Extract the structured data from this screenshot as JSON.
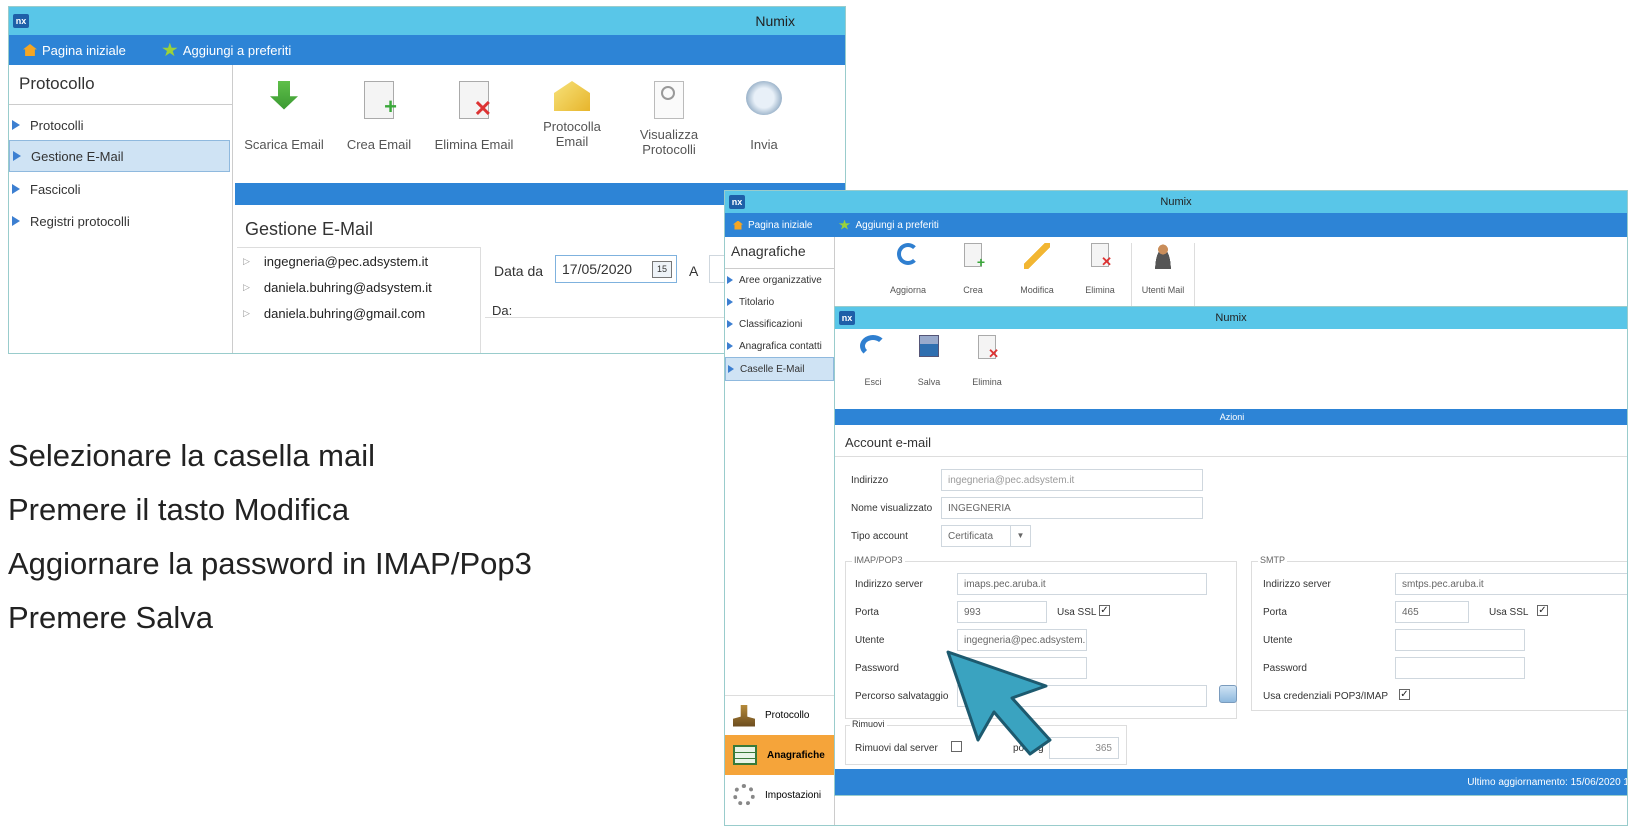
{
  "window1": {
    "title": "Numix",
    "logo": "nx",
    "nav": {
      "home": "Pagina iniziale",
      "favorites": "Aggiungi a preferiti"
    },
    "sidebar": {
      "header": "Protocollo",
      "items": [
        {
          "label": "Protocolli"
        },
        {
          "label": "Gestione E-Mail"
        },
        {
          "label": "Fascicoli"
        },
        {
          "label": "Registri protocolli"
        }
      ]
    },
    "toolbar": [
      {
        "label": "Scarica Email",
        "icon": "download-icon"
      },
      {
        "label": "Crea Email",
        "icon": "new-document-icon"
      },
      {
        "label": "Elimina Email",
        "icon": "delete-document-icon"
      },
      {
        "label": "Protocolla Email",
        "icon": "open-envelope-icon"
      },
      {
        "label": "Visualizza Protocolli",
        "icon": "magnifier-icon"
      },
      {
        "label": "Invia",
        "icon": "send-icon"
      }
    ],
    "section_title": "Gestione E-Mail",
    "mailboxes": [
      "ingegneria@pec.adsystem.it",
      "daniela.buhring@adsystem.it",
      "daniela.buhring@gmail.com"
    ],
    "date_from_label": "Data da",
    "date_from_value": "17/05/2020",
    "calendar_day": "15",
    "date_to_label": "A",
    "from_label": "Da:"
  },
  "instructions": [
    "Selezionare la  casella mail",
    "Premere il tasto Modifica",
    "Aggiornare la password in IMAP/Pop3",
    "Premere Salva"
  ],
  "window2": {
    "title": "Numix",
    "logo": "nx",
    "nav": {
      "home": "Pagina iniziale",
      "favorites": "Aggiungi a preferiti"
    },
    "sidebar": {
      "header": "Anagrafiche",
      "items": [
        {
          "label": "Aree organizzative"
        },
        {
          "label": "Titolario"
        },
        {
          "label": "Classificazioni"
        },
        {
          "label": "Anagrafica contatti"
        },
        {
          "label": "Caselle E-Mail"
        }
      ],
      "modules": [
        {
          "label": "Protocollo",
          "icon": "stamp-icon"
        },
        {
          "label": "Anagrafiche",
          "icon": "table-icon"
        },
        {
          "label": "Impostazioni",
          "icon": "gear-icon"
        }
      ]
    },
    "toolbar": [
      {
        "label": "Aggiorna",
        "icon": "refresh-icon"
      },
      {
        "label": "Crea",
        "icon": "new-document-icon"
      },
      {
        "label": "Modifica",
        "icon": "pencil-icon"
      },
      {
        "label": "Elimina",
        "icon": "delete-document-icon"
      },
      {
        "label": "Utenti Mail",
        "icon": "user-icon"
      }
    ]
  },
  "window3": {
    "title": "Numix",
    "logo": "nx",
    "toolbar": [
      {
        "label": "Esci",
        "icon": "back-arrow-icon"
      },
      {
        "label": "Salva",
        "icon": "save-icon"
      },
      {
        "label": "Elimina",
        "icon": "delete-document-icon"
      }
    ],
    "actions_label": "Azioni",
    "section_title": "Account e-mail",
    "form": {
      "address_label": "Indirizzo",
      "address_value": "ingegneria@pec.adsystem.it",
      "display_name_label": "Nome visualizzato",
      "display_name_value": "INGEGNERIA",
      "account_type_label": "Tipo account",
      "account_type_value": "Certificata"
    },
    "imap": {
      "group_label": "IMAP/POP3",
      "server_label": "Indirizzo server",
      "server_value": "imaps.pec.aruba.it",
      "port_label": "Porta",
      "port_value": "993",
      "ssl_label": "Usa SSL",
      "user_label": "Utente",
      "user_value": "ingegneria@pec.adsystem.",
      "password_label": "Password",
      "password_value": "",
      "save_path_label": "Percorso salvataggio"
    },
    "smtp": {
      "group_label": "SMTP",
      "server_label": "Indirizzo server",
      "server_value": "smtps.pec.aruba.it",
      "port_label": "Porta",
      "port_value": "465",
      "ssl_label": "Usa SSL",
      "user_label": "Utente",
      "password_label": "Password",
      "use_creds_label": "Usa credenziali POP3/IMAP"
    },
    "remove": {
      "group_label": "Rimuovi",
      "from_server_label": "Rimuovi dal server",
      "days_label_partial": "po n. g",
      "days_value": "365"
    },
    "status": "Ultimo aggiornamento: 15/06/2020 1"
  },
  "colors": {
    "titlebar": "#59c6e8",
    "navbar": "#2d84d6",
    "pointer": "#3aa3c0",
    "selected": "#cfe3f4"
  }
}
